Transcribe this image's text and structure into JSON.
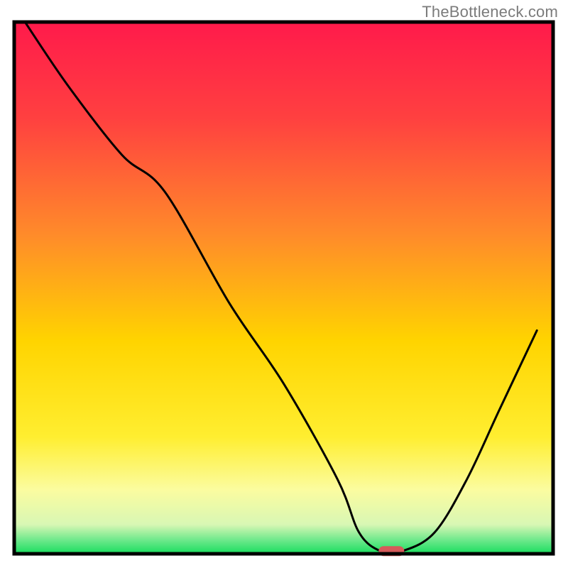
{
  "watermark": "TheBottleneck.com",
  "chart_data": {
    "type": "line",
    "title": "",
    "xlabel": "",
    "ylabel": "",
    "xlim": [
      0,
      100
    ],
    "ylim": [
      0,
      100
    ],
    "x": [
      2,
      10,
      20,
      28,
      40,
      50,
      60,
      64,
      68,
      72,
      78,
      84,
      90,
      97
    ],
    "values": [
      100,
      88,
      75,
      68,
      47,
      32,
      14,
      4,
      0.5,
      0.5,
      4,
      14,
      27,
      42
    ],
    "marker": {
      "x": 70,
      "y": 0.5
    },
    "gradient_stops": [
      {
        "offset": 0.0,
        "color": "#ff1a4b"
      },
      {
        "offset": 0.18,
        "color": "#ff4040"
      },
      {
        "offset": 0.4,
        "color": "#ff8b2a"
      },
      {
        "offset": 0.6,
        "color": "#ffd400"
      },
      {
        "offset": 0.78,
        "color": "#ffee30"
      },
      {
        "offset": 0.88,
        "color": "#fbfca0"
      },
      {
        "offset": 0.945,
        "color": "#d8f7b4"
      },
      {
        "offset": 0.975,
        "color": "#6be88a"
      },
      {
        "offset": 1.0,
        "color": "#18dd5e"
      }
    ],
    "frame_color": "#000000",
    "curve_color": "#000000",
    "marker_color": "#d65a5a"
  }
}
